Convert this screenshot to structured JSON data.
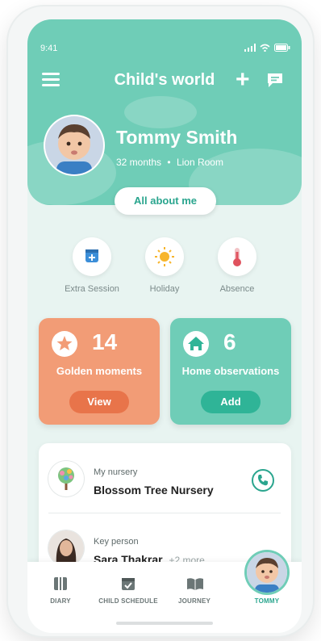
{
  "status": {
    "time": "9:41"
  },
  "header": {
    "title": "Child's world"
  },
  "child": {
    "name": "Tommy Smith",
    "age": "32 months",
    "separator": "•",
    "room": "Lion Room"
  },
  "about_button": "All about me",
  "quick_actions": [
    {
      "label": "Extra Session",
      "icon": "calendar-plus-icon"
    },
    {
      "label": "Holiday",
      "icon": "sun-icon"
    },
    {
      "label": "Absence",
      "icon": "thermometer-icon"
    }
  ],
  "cards": {
    "golden": {
      "count": "14",
      "label": "Golden moments",
      "button": "View",
      "icon": "star-icon"
    },
    "home": {
      "count": "6",
      "label": "Home observations",
      "button": "Add",
      "icon": "house-icon"
    }
  },
  "nursery": {
    "small": "My nursery",
    "name": "Blossom Tree Nursery"
  },
  "key_person": {
    "small": "Key person",
    "name": "Sara Thakrar",
    "more": "+2 more"
  },
  "tabs": [
    {
      "label": "DIARY",
      "icon": "diary-icon"
    },
    {
      "label": "CHILD SCHEDULE",
      "icon": "schedule-icon"
    },
    {
      "label": "JOURNEY",
      "icon": "book-icon"
    },
    {
      "label": "TOMMY",
      "icon": "avatar"
    }
  ],
  "colors": {
    "teal": "#6fcdb7",
    "accent": "#2aa58e",
    "orange": "#f29c76",
    "orange_dark": "#e8744a"
  }
}
